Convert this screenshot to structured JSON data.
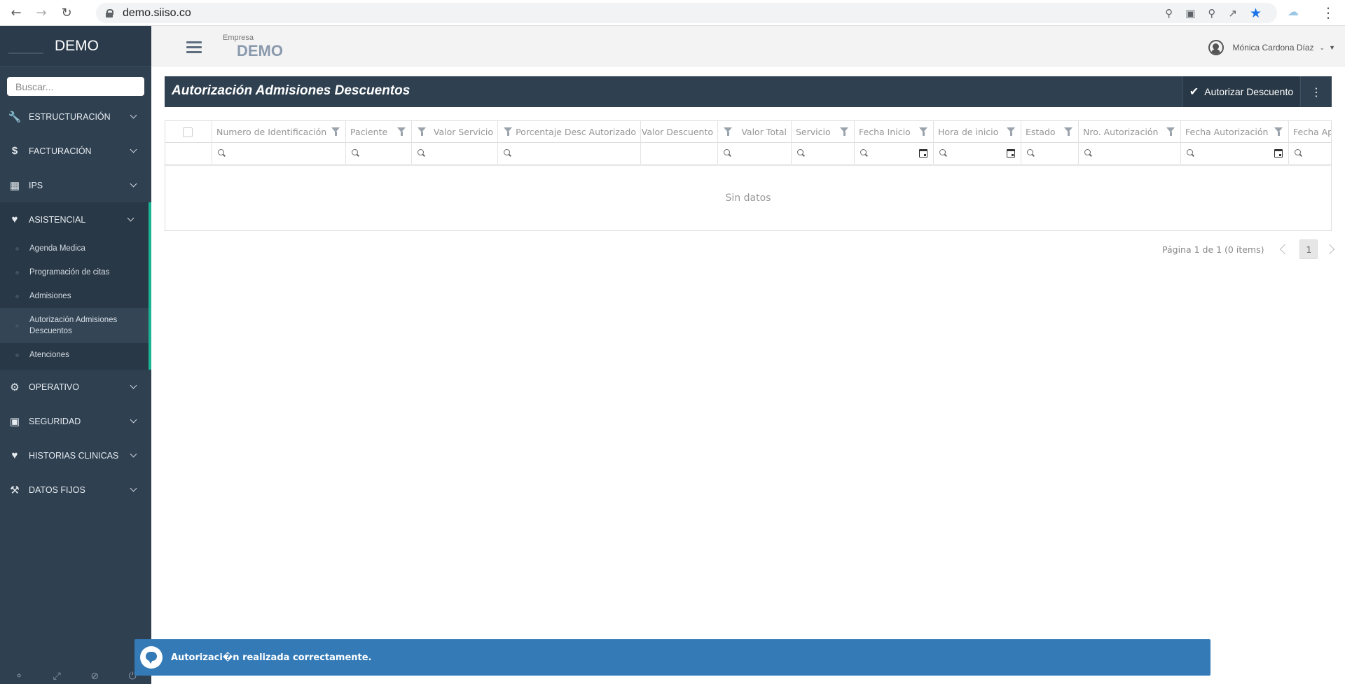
{
  "browser": {
    "url": "demo.siiso.co",
    "icons": [
      "back-icon",
      "forward-icon",
      "reload-icon",
      "location-icon",
      "translate-icon",
      "zoom-icon",
      "share-icon",
      "star-icon",
      "extension-icon",
      "menu-icon"
    ]
  },
  "sidebar": {
    "brand": "DEMO",
    "search_placeholder": "Buscar...",
    "items": [
      {
        "label": "ESTRUCTURACIÓN",
        "icon": "wrench-icon"
      },
      {
        "label": "FACTURACIÓN",
        "icon": "dollar-icon"
      },
      {
        "label": "IPS",
        "icon": "hospital-icon"
      },
      {
        "label": "ASISTENCIAL",
        "icon": "heart-icon"
      },
      {
        "label": "OPERATIVO",
        "icon": "gears-icon"
      },
      {
        "label": "SEGURIDAD",
        "icon": "lock-icon"
      },
      {
        "label": "HISTORIAS CLINICAS",
        "icon": "heartbeat-icon"
      },
      {
        "label": "DATOS FIJOS",
        "icon": "gavel-icon"
      }
    ],
    "submenu": [
      "Agenda Medica",
      "Programación de citas",
      "Admisiones",
      "Autorización Admisiones Descuentos",
      "Atenciones"
    ]
  },
  "header": {
    "company_label": "Empresa",
    "company_name": "DEMO",
    "user_name": "Mónica Cardona Díaz"
  },
  "page": {
    "title": "Autorización Admisiones Descuentos",
    "authorize_button": "Autorizar Descuento"
  },
  "grid": {
    "columns": [
      "Numero de Identificación",
      "Paciente",
      "Valor Servicio",
      "Porcentaje Desc Autorizado",
      "Valor Descuento",
      "Valor Total",
      "Servicio",
      "Fecha Inicio",
      "Hora de inicio",
      "Estado",
      "Nro. Autorización",
      "Fecha Autorización",
      "Fecha Apr"
    ],
    "no_data": "Sin datos"
  },
  "pager": {
    "info": "Página 1 de 1 (0 ítems)",
    "current_page": "1"
  },
  "toast": {
    "message": "Autorizaci�n realizada correctamente."
  },
  "colors": {
    "sidebar_bg": "#2f4050",
    "accent": "#1ab394",
    "toast_bg": "#337ab7"
  }
}
